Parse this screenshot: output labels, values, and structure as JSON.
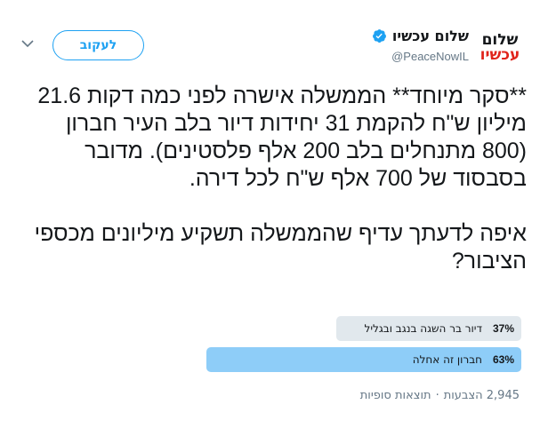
{
  "account": {
    "avatar_line1": "שלום",
    "avatar_line2": "עכשיו",
    "display_name": "שלום עכשיו",
    "handle": "@PeaceNowIL",
    "follow_label": "לעקוב"
  },
  "tweet": {
    "paragraph1": "**סקר מיוחד** הממשלה אישרה לפני כמה דקות 21.6 מיליון ש\"ח להקמת 31 יחידות דיור בלב העיר חברון (800 מתנחלים בלב 200 אלף פלסטינים). מדובר בסבסוד של 700 אלף ש\"ח לכל דירה.",
    "paragraph2": "איפה לדעתך עדיף שהממשלה תשקיע מיליונים מכספי הציבור?"
  },
  "poll": {
    "choices": [
      {
        "label": "דיור בר השגה בנגב ובגליל",
        "percent_text": "37%",
        "percent": 37,
        "color": "#e1e8ed"
      },
      {
        "label": "חברון זה אחלה",
        "percent_text": "63%",
        "percent": 63,
        "color": "#8ecdf8"
      }
    ],
    "votes": "2,945 הצבעות",
    "separator": "·",
    "status": "תוצאות סופיות"
  },
  "colors": {
    "accent": "#1da1f2",
    "verified": "#1da1f2",
    "brand_red": "#e0241b"
  }
}
